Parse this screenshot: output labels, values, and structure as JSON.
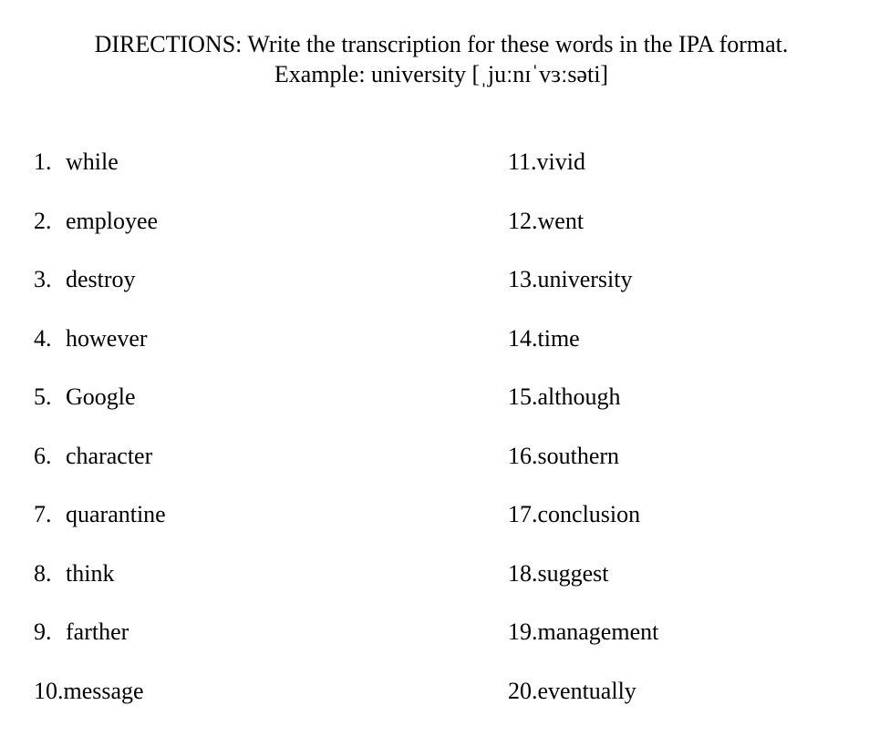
{
  "directions": {
    "line1": "DIRECTIONS: Write the transcription for these words in the IPA format.",
    "line2": "Example: university [ˌjuːnɪˈvɜːsəti]"
  },
  "left_items": [
    {
      "number": "1.",
      "word": "while"
    },
    {
      "number": "2.",
      "word": "employee"
    },
    {
      "number": "3.",
      "word": "destroy"
    },
    {
      "number": "4.",
      "word": "however"
    },
    {
      "number": "5.",
      "word": "Google"
    },
    {
      "number": "6.",
      "word": "character"
    },
    {
      "number": "7.",
      "word": "quarantine"
    },
    {
      "number": "8.",
      "word": "think"
    },
    {
      "number": "9.",
      "word": "farther"
    },
    {
      "number": "10.",
      "word": "message"
    }
  ],
  "right_items": [
    {
      "number": "11.",
      "word": "vivid"
    },
    {
      "number": "12.",
      "word": "went"
    },
    {
      "number": "13.",
      "word": "university"
    },
    {
      "number": "14.",
      "word": "time"
    },
    {
      "number": "15.",
      "word": "although"
    },
    {
      "number": "16.",
      "word": "southern"
    },
    {
      "number": "17.",
      "word": "conclusion"
    },
    {
      "number": "18.",
      "word": "suggest"
    },
    {
      "number": "19.",
      "word": "management"
    },
    {
      "number": "20.",
      "word": "eventually"
    }
  ]
}
